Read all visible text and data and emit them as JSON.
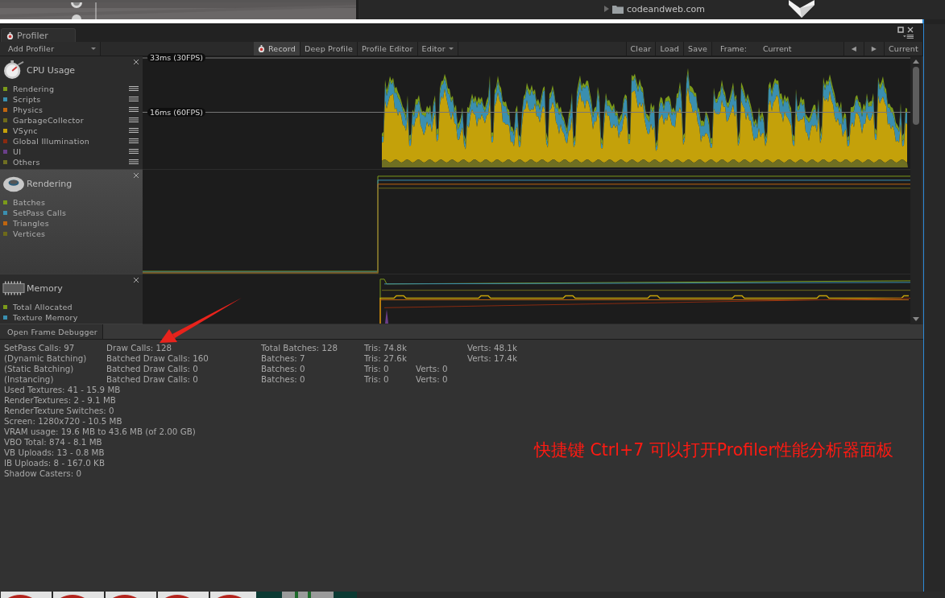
{
  "project_panel": {
    "items": [
      {
        "label": "codeandweb.com",
        "expanded": false
      }
    ]
  },
  "profiler": {
    "tab": {
      "label": "Profiler"
    },
    "toolbar": {
      "add_profiler": "Add Profiler",
      "toggles": [
        {
          "label": "Record",
          "on": true,
          "kind": "record"
        },
        {
          "label": "Deep Profile",
          "on": false,
          "kind": "plain"
        },
        {
          "label": "Profile Editor",
          "on": false,
          "kind": "plain"
        },
        {
          "label": "Editor",
          "on": false,
          "kind": "dropdown"
        }
      ],
      "actions": [
        "Clear",
        "Load",
        "Save"
      ],
      "frame_label": "Frame:",
      "frame_value": "Current",
      "prev": "◀",
      "next": "▶",
      "current_button": "Current"
    },
    "modules": [
      {
        "kind": "cpu",
        "title": "CPU Usage",
        "selected": false,
        "legend": [
          {
            "label": "Rendering",
            "color": "#7b9a1a"
          },
          {
            "label": "Scripts",
            "color": "#3a8fb0"
          },
          {
            "label": "Physics",
            "color": "#c0650f"
          },
          {
            "label": "GarbageCollector",
            "color": "#6e6a1a"
          },
          {
            "label": "VSync",
            "color": "#c4a10a"
          },
          {
            "label": "Global Illumination",
            "color": "#8a2a10"
          },
          {
            "label": "UI",
            "color": "#6a3f8a"
          },
          {
            "label": "Others",
            "color": "#6f6f22"
          }
        ],
        "guides": [
          "33ms (30FPS)",
          "16ms (60FPS)"
        ]
      },
      {
        "kind": "rendering",
        "title": "Rendering",
        "selected": true,
        "legend": [
          {
            "label": "Batches",
            "color": "#7b9a1a"
          },
          {
            "label": "SetPass Calls",
            "color": "#3a8fb0"
          },
          {
            "label": "Triangles",
            "color": "#c0650f"
          },
          {
            "label": "Vertices",
            "color": "#6e6a1a"
          }
        ]
      },
      {
        "kind": "memory",
        "title": "Memory",
        "selected": false,
        "legend": [
          {
            "label": "Total Allocated",
            "color": "#7b9a1a"
          },
          {
            "label": "Texture Memory",
            "color": "#3a8fb0"
          }
        ]
      }
    ],
    "frame_debugger_button": "Open Frame Debugger",
    "batch_stats": [
      {
        "kind": "wide",
        "cells": [
          "SetPass Calls: 97",
          "Draw Calls: 128",
          "Total Batches: 128",
          "Tris: 74.8k",
          "Verts: 48.1k"
        ]
      },
      {
        "kind": "wide",
        "cells": [
          "(Dynamic Batching)",
          "Batched Draw Calls: 160",
          "Batches: 7",
          "Tris: 27.6k",
          "Verts: 17.4k"
        ]
      },
      {
        "kind": "narrow",
        "cells": [
          "(Static Batching)",
          "Batched Draw Calls: 0",
          "Batches: 0",
          "Tris: 0",
          "Verts: 0"
        ]
      },
      {
        "kind": "narrow",
        "cells": [
          "(Instancing)",
          "Batched Draw Calls: 0",
          "Batches: 0",
          "Tris: 0",
          "Verts: 0"
        ]
      }
    ],
    "memory_stats": [
      "Used Textures: 41 - 15.9 MB",
      "RenderTextures: 2 - 9.1 MB",
      "RenderTexture Switches: 0",
      "Screen: 1280x720 - 10.5 MB",
      "VRAM usage: 19.6 MB to 43.6 MB (of 2.00 GB)",
      "VBO Total: 874 - 8.1 MB",
      "VB Uploads: 13 - 0.8 MB",
      "IB Uploads: 8 - 167.0 KB",
      "Shadow Casters: 0"
    ]
  },
  "annotation": {
    "text": "快捷键 Ctrl+7 可以打开Profiler性能分析器面板"
  }
}
